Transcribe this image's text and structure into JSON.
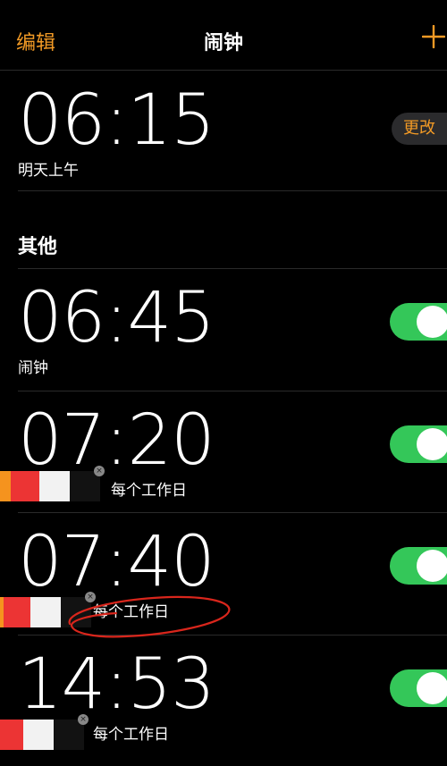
{
  "navbar": {
    "edit_label": "编辑",
    "title": "闹钟",
    "add_icon": "plus-icon"
  },
  "sleep": {
    "time": "06:15",
    "subtitle": "明天上午",
    "change_label": "更改"
  },
  "other_section": {
    "header": "其他"
  },
  "alarms": [
    {
      "time": "06:45",
      "label": "闹钟",
      "enabled": true
    },
    {
      "time": "07:20",
      "label": "每个工作日",
      "enabled": true
    },
    {
      "time": "07:40",
      "label": "每个工作日",
      "enabled": true
    },
    {
      "time": "14:53",
      "label": "每个工作日",
      "enabled": true
    }
  ],
  "colors": {
    "accent": "#f29a25",
    "toggle_on": "#34c759",
    "background": "#000000",
    "annotation": "#d9261c"
  }
}
